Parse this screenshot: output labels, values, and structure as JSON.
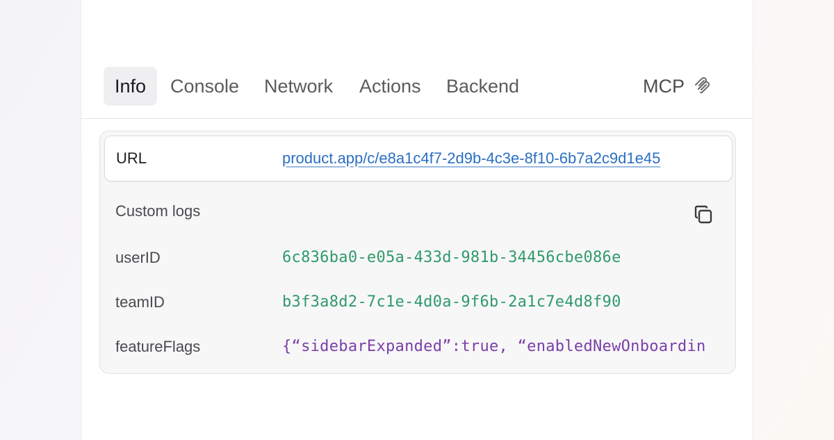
{
  "tabs": {
    "info": "Info",
    "console": "Console",
    "network": "Network",
    "actions": "Actions",
    "backend": "Backend",
    "mcp": "MCP"
  },
  "url_row": {
    "label": "URL",
    "value": "product.app/c/e8a1c4f7-2d9b-4c3e-8f10-6b7a2c9d1e45"
  },
  "custom_logs": {
    "title": "Custom logs",
    "rows": [
      {
        "key": "userID",
        "value": "6c836ba0-e05a-433d-981b-34456cbe086e"
      },
      {
        "key": "teamID",
        "value": "b3f3a8d2-7c1e-4d0a-9f6b-2a1c7e4d8f90"
      },
      {
        "key": "featureFlags",
        "value": "{“sidebarExpanded”:true, “enabledNewOnboardin"
      }
    ]
  },
  "icons": {
    "mcp": "mcp-icon",
    "copy": "copy-icon"
  },
  "colors": {
    "link": "#2b6fc2",
    "id_value": "#2f9a6a",
    "json_value": "#7a3fa6",
    "active_tab_bg": "#efeff1"
  }
}
